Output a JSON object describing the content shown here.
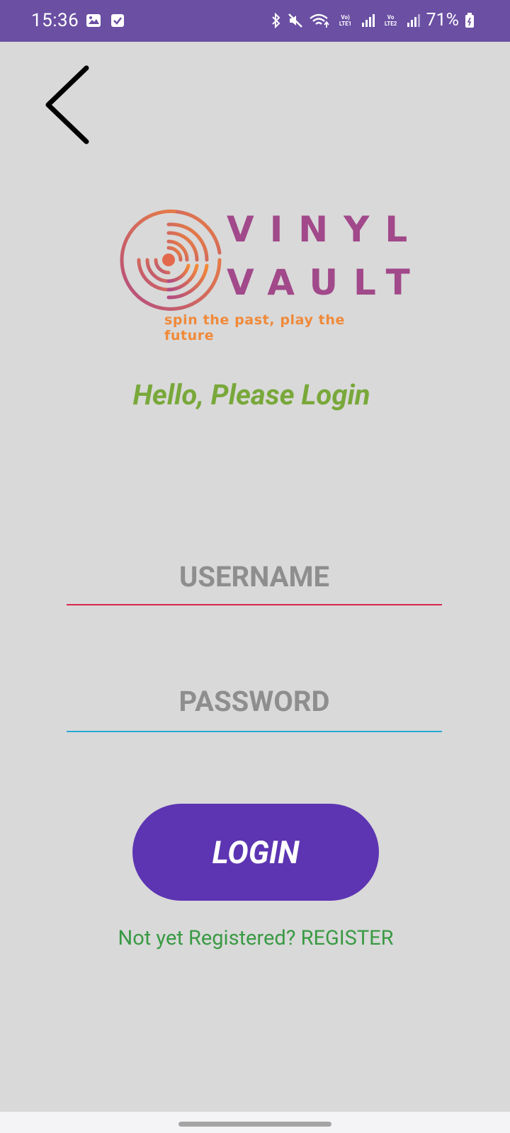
{
  "status_bar": {
    "time": "15:36",
    "left_icons": [
      "image-icon",
      "checkbox-icon"
    ],
    "right_icons": [
      "bluetooth-icon",
      "mute-icon",
      "wifi-icon",
      "signal-icon",
      "signal-icon",
      "battery-icon"
    ],
    "volte1": "Vo) LTE1",
    "volte2": "Vo LTE2",
    "battery": "71%"
  },
  "nav": {
    "back_icon": "chevron-left-icon"
  },
  "logo": {
    "line1": "VINYL",
    "line2": "VAULT",
    "tagline": "spin the past, play the future",
    "colors": {
      "orange": "#f08a3a",
      "magenta": "#a1498a"
    }
  },
  "greeting": "Hello, Please Login",
  "form": {
    "username_placeholder": "USERNAME",
    "password_placeholder": "PASSWORD",
    "login_label": "LOGIN"
  },
  "register": {
    "text": "Not yet Registered? REGISTER"
  },
  "colors": {
    "status_bar": "#6a4fa3",
    "background": "#d9d9d9",
    "greeting": "#79a83a",
    "button": "#5d35b2",
    "username_underline": "#d8284f",
    "password_underline": "#27a9d4",
    "register": "#3a9a44"
  }
}
